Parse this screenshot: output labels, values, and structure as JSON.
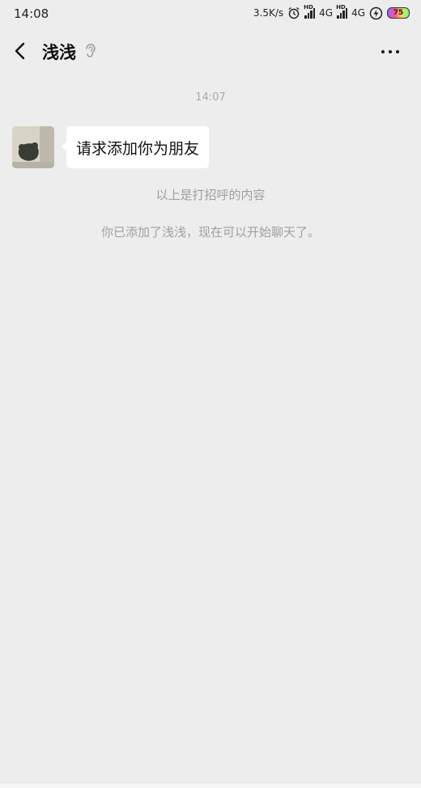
{
  "status_bar": {
    "time": "14:08",
    "net_speed": "3.5K/s",
    "sim1_label": "4G",
    "sim2_label": "4G",
    "hd_label": "HD",
    "battery_level": "75",
    "icons": [
      "alarm-icon",
      "signal-icon",
      "signal-icon",
      "charging-icon",
      "battery-icon"
    ]
  },
  "nav": {
    "title": "浅浅",
    "icons": [
      "back-arrow-icon",
      "ear-icon",
      "more-icon"
    ]
  },
  "chat": {
    "timestamp": "14:07",
    "message_text": "请求添加你为朋友",
    "system_1": "以上是打招呼的内容",
    "system_2": "你已添加了浅浅，现在可以开始聊天了。"
  },
  "colors": {
    "background": "#ededed",
    "bubble": "#ffffff",
    "muted_text": "#a0a0a0"
  }
}
